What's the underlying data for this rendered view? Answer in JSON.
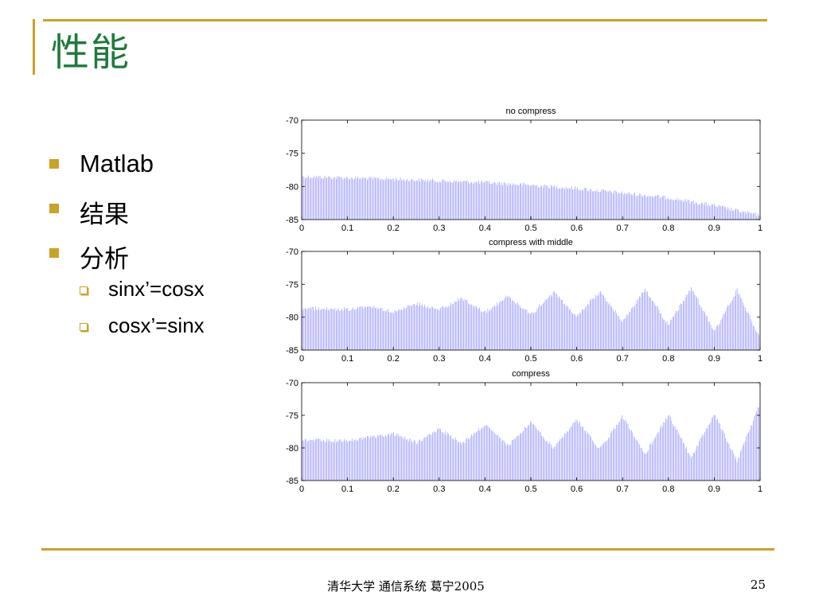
{
  "slide": {
    "title": "性能",
    "bullets": [
      {
        "level": 1,
        "text": "Matlab"
      },
      {
        "level": 1,
        "text": "结果"
      },
      {
        "level": 1,
        "text": "分析"
      },
      {
        "level": 2,
        "text": "sinx’=cosx"
      },
      {
        "level": 2,
        "text": "cosx’=sinx"
      }
    ],
    "footer": {
      "center": "清华大学 通信系统 葛宁2005",
      "page": "25"
    }
  },
  "colors": {
    "title": "#1e7a3c",
    "accent": "#c9a227",
    "bullet_square": "#c9a227",
    "series": "#0000ff",
    "axis": "#000000"
  },
  "chart_data": [
    {
      "type": "line",
      "title": "no compress",
      "xlabel": "",
      "ylabel": "",
      "xlim": [
        0,
        1
      ],
      "ylim": [
        -85,
        -70
      ],
      "xticks": [
        "0",
        "0.1",
        "0.2",
        "0.3",
        "0.4",
        "0.5",
        "0.6",
        "0.7",
        "0.8",
        "0.9",
        "1"
      ],
      "yticks": [
        "-70",
        "-75",
        "-80",
        "-85"
      ],
      "grid": false,
      "series": [
        {
          "x_start": 0,
          "x_end": 1,
          "samples": 400,
          "y_floor": -85,
          "envelope_x": [
            0,
            0.2,
            0.4,
            0.5,
            0.6,
            0.7,
            0.8,
            0.9,
            1.0
          ],
          "envelope_y": [
            -78.2,
            -78.6,
            -79.1,
            -79.5,
            -80.0,
            -80.7,
            -81.4,
            -82.6,
            -84.1
          ]
        }
      ]
    },
    {
      "type": "line",
      "title": "compress with middle",
      "xlabel": "",
      "ylabel": "",
      "xlim": [
        0,
        1
      ],
      "ylim": [
        -85,
        -70
      ],
      "xticks": [
        "0",
        "0.1",
        "0.2",
        "0.3",
        "0.4",
        "0.5",
        "0.6",
        "0.7",
        "0.8",
        "0.9",
        "1"
      ],
      "yticks": [
        "-70",
        "-75",
        "-80",
        "-85"
      ],
      "grid": false,
      "series": [
        {
          "x_start": 0,
          "x_end": 1,
          "samples": 400,
          "y_floor": -85,
          "envelope_x": [
            0,
            0.05,
            0.1,
            0.15,
            0.2,
            0.25,
            0.3,
            0.35,
            0.4,
            0.45,
            0.5,
            0.55,
            0.6,
            0.65,
            0.7,
            0.75,
            0.8,
            0.85,
            0.9,
            0.95,
            1.0
          ],
          "envelope_y": [
            -78.4,
            -78.4,
            -78.5,
            -78.0,
            -78.9,
            -77.6,
            -78.6,
            -76.8,
            -79.0,
            -76.5,
            -79.3,
            -76.0,
            -79.5,
            -75.8,
            -80.3,
            -75.5,
            -80.9,
            -75.2,
            -82.0,
            -75.5,
            -83.0
          ]
        }
      ]
    },
    {
      "type": "line",
      "title": "compress",
      "xlabel": "",
      "ylabel": "",
      "xlim": [
        0,
        1
      ],
      "ylim": [
        -85,
        -70
      ],
      "xticks": [
        "0",
        "0.1",
        "0.2",
        "0.3",
        "0.4",
        "0.5",
        "0.6",
        "0.7",
        "0.8",
        "0.9",
        "1"
      ],
      "yticks": [
        "-70",
        "-75",
        "-80",
        "-85"
      ],
      "grid": false,
      "series": [
        {
          "x_start": 0,
          "x_end": 1,
          "samples": 400,
          "y_floor": -85,
          "envelope_x": [
            0,
            0.1,
            0.2,
            0.25,
            0.3,
            0.35,
            0.4,
            0.45,
            0.5,
            0.55,
            0.6,
            0.65,
            0.7,
            0.75,
            0.8,
            0.85,
            0.9,
            0.95,
            1.0
          ],
          "envelope_y": [
            -78.5,
            -78.6,
            -77.5,
            -78.9,
            -76.8,
            -79.0,
            -76.2,
            -79.4,
            -75.7,
            -79.8,
            -75.3,
            -80.0,
            -74.9,
            -80.6,
            -74.6,
            -81.2,
            -74.4,
            -81.8,
            -72.8
          ]
        }
      ]
    }
  ]
}
